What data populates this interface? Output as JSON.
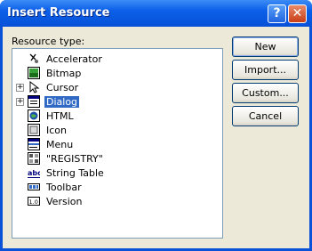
{
  "window": {
    "title": "Insert Resource",
    "help_glyph": "?",
    "close_glyph": "✕"
  },
  "list": {
    "label": "Resource type:",
    "items": [
      {
        "label": "Accelerator",
        "icon": "accelerator-icon",
        "expandable": false
      },
      {
        "label": "Bitmap",
        "icon": "bitmap-icon",
        "expandable": false
      },
      {
        "label": "Cursor",
        "icon": "cursor-icon",
        "expandable": true
      },
      {
        "label": "Dialog",
        "icon": "dialog-icon",
        "expandable": true,
        "selected": true
      },
      {
        "label": "HTML",
        "icon": "html-icon",
        "expandable": false
      },
      {
        "label": "Icon",
        "icon": "icon-resource-icon",
        "expandable": false
      },
      {
        "label": "Menu",
        "icon": "menu-icon",
        "expandable": false
      },
      {
        "label": "\"REGISTRY\"",
        "icon": "registry-icon",
        "expandable": false
      },
      {
        "label": "String Table",
        "icon": "string-table-icon",
        "expandable": false
      },
      {
        "label": "Toolbar",
        "icon": "toolbar-icon",
        "expandable": false
      },
      {
        "label": "Version",
        "icon": "version-icon",
        "expandable": false
      }
    ],
    "expand_glyph": "+"
  },
  "buttons": {
    "new": "New",
    "import": "Import...",
    "custom": "Custom...",
    "cancel": "Cancel"
  },
  "colors": {
    "titlebar": "#0b5fe8",
    "selection": "#316ac5",
    "face": "#ece9d8"
  }
}
